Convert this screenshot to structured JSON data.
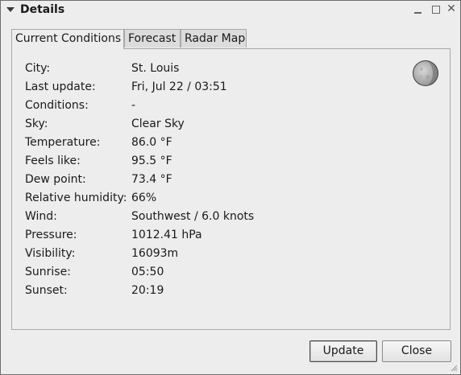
{
  "window": {
    "title": "Details"
  },
  "tabs": [
    {
      "label": "Current Conditions",
      "active": true
    },
    {
      "label": "Forecast",
      "active": false
    },
    {
      "label": "Radar Map",
      "active": false
    }
  ],
  "conditions": [
    {
      "label": "City:",
      "value": "St. Louis"
    },
    {
      "label": "Last update:",
      "value": "Fri, Jul 22 / 03:51"
    },
    {
      "label": "Conditions:",
      "value": "-"
    },
    {
      "label": "Sky:",
      "value": "Clear Sky"
    },
    {
      "label": "Temperature:",
      "value": "86.0 °F"
    },
    {
      "label": "Feels like:",
      "value": "95.5 °F"
    },
    {
      "label": "Dew point:",
      "value": "73.4 °F"
    },
    {
      "label": "Relative humidity:",
      "value": "66%"
    },
    {
      "label": "Wind:",
      "value": "Southwest / 6.0 knots"
    },
    {
      "label": "Pressure:",
      "value": "1012.41 hPa"
    },
    {
      "label": "Visibility:",
      "value": "16093m"
    },
    {
      "label": "Sunrise:",
      "value": "05:50"
    },
    {
      "label": "Sunset:",
      "value": "20:19"
    }
  ],
  "icons": {
    "moon": "moon-phase-icon"
  },
  "buttons": {
    "update_label": "Update",
    "close_label": "Close"
  }
}
